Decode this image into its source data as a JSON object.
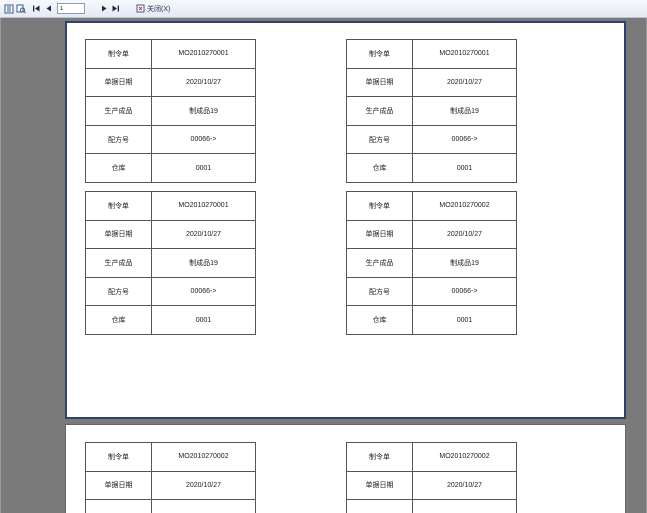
{
  "toolbar": {
    "page_value": "1",
    "close_label": "关闭(X)"
  },
  "field_labels": {
    "order": "制令单",
    "date": "单据日期",
    "product": "生产成品",
    "formula": "配方号",
    "warehouse": "仓库"
  },
  "pages": [
    {
      "cards": [
        {
          "order": "MO2010270001",
          "date": "2020/10/27",
          "product": "制成品19",
          "formula": "00066->",
          "warehouse": "0001"
        },
        {
          "order": "MO2010270001",
          "date": "2020/10/27",
          "product": "制成品19",
          "formula": "00066->",
          "warehouse": "0001"
        },
        {
          "order": "MO2010270001",
          "date": "2020/10/27",
          "product": "制成品19",
          "formula": "00066->",
          "warehouse": "0001"
        },
        {
          "order": "MO2010270002",
          "date": "2020/10/27",
          "product": "制成品19",
          "formula": "00066->",
          "warehouse": "0001"
        }
      ]
    },
    {
      "cards": [
        {
          "order": "MO2010270002",
          "date": "2020/10/27"
        },
        {
          "order": "MO2010270002",
          "date": "2020/10/27"
        }
      ]
    }
  ]
}
